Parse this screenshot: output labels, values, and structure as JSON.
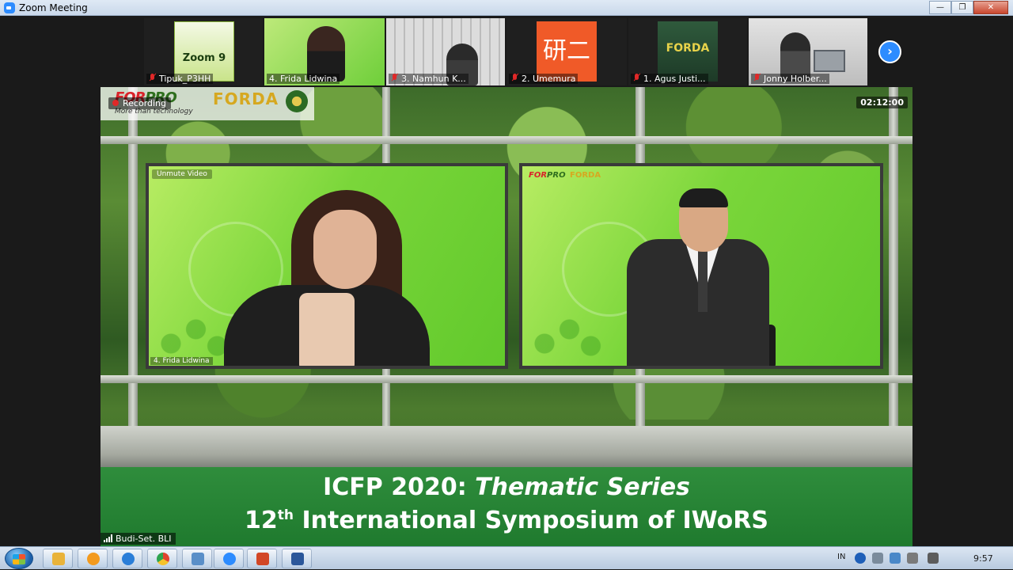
{
  "window": {
    "title": "Zoom Meeting",
    "minimize": "—",
    "maximize": "❐",
    "close": "✕"
  },
  "thumbnails": [
    {
      "name": "Tipuk_P3HH",
      "muted": true,
      "content": "Zoom 9"
    },
    {
      "name": "4. Frida Lidwina",
      "muted": false
    },
    {
      "name": "3. Namhun K...",
      "muted": true
    },
    {
      "name": "2. Umemura",
      "muted": true,
      "content": "研二"
    },
    {
      "name": "1. Agus Justi...",
      "muted": true,
      "content": "FORDA"
    },
    {
      "name": "Jonny Holber...",
      "muted": true
    }
  ],
  "next_page_icon": "chevron-right-icon",
  "stage": {
    "recording_label": "Recording",
    "timer": "02:12:00",
    "logo_forpro_a": "FOR",
    "logo_forpro_b": "PRO",
    "logo_tagline": "More than technology",
    "logo_forda": "FORDA",
    "panel_left_unmute": "Unmute Video",
    "panel_left_name": "4. Frida Lidwina",
    "panel_right_forpro_a": "FOR",
    "panel_right_forpro_b": "PRO",
    "panel_right_forda": "FORDA",
    "banner_line1_a": "ICFP 2020: ",
    "banner_line1_b": "Thematic Series",
    "banner_line2_num": "12",
    "banner_line2_sup": "th",
    "banner_line2_rest": " International Symposium of IWoRS",
    "active_speaker": "Budi-Set. BLI"
  },
  "taskbar": {
    "apps": [
      {
        "name": "file-explorer",
        "color": "#e9b33a"
      },
      {
        "name": "media-player",
        "color": "#f39a1e"
      },
      {
        "name": "internet-explorer",
        "color": "#2a7ed8"
      },
      {
        "name": "chrome",
        "color": "#e0442f"
      },
      {
        "name": "network-app",
        "color": "#5a8fc8"
      },
      {
        "name": "zoom",
        "color": "#2d8cff"
      },
      {
        "name": "powerpoint",
        "color": "#d24726"
      },
      {
        "name": "word",
        "color": "#2b579a"
      }
    ],
    "tray": {
      "language": "IN",
      "clock": "9:57"
    }
  }
}
